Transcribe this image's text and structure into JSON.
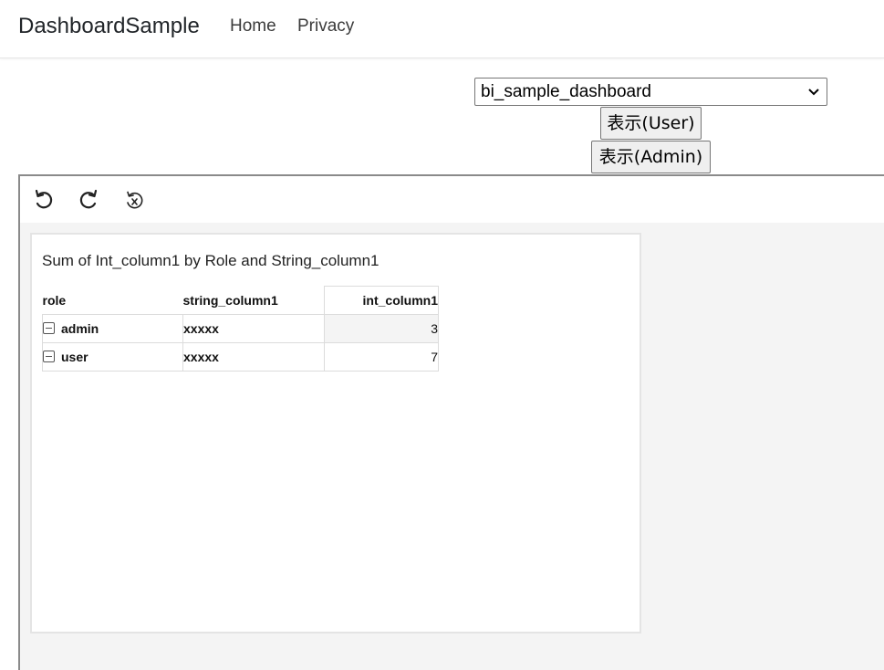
{
  "navbar": {
    "brand": "DashboardSample",
    "links": [
      "Home",
      "Privacy"
    ]
  },
  "dashboard_select": {
    "selected": "bi_sample_dashboard"
  },
  "buttons": {
    "user": "表示(User)",
    "admin": "表示(Admin)"
  },
  "toolbar": {
    "icons": [
      "undo-icon",
      "redo-icon",
      "reset-icon"
    ]
  },
  "visual": {
    "title": "Sum of Int_column1 by Role and String_column1",
    "headers": [
      "role",
      "string_column1",
      "int_column1"
    ],
    "rows": [
      {
        "role": "admin",
        "string_column1": "xxxxx",
        "int_column1": "3"
      },
      {
        "role": "user",
        "string_column1": "xxxxx",
        "int_column1": "7"
      }
    ]
  }
}
